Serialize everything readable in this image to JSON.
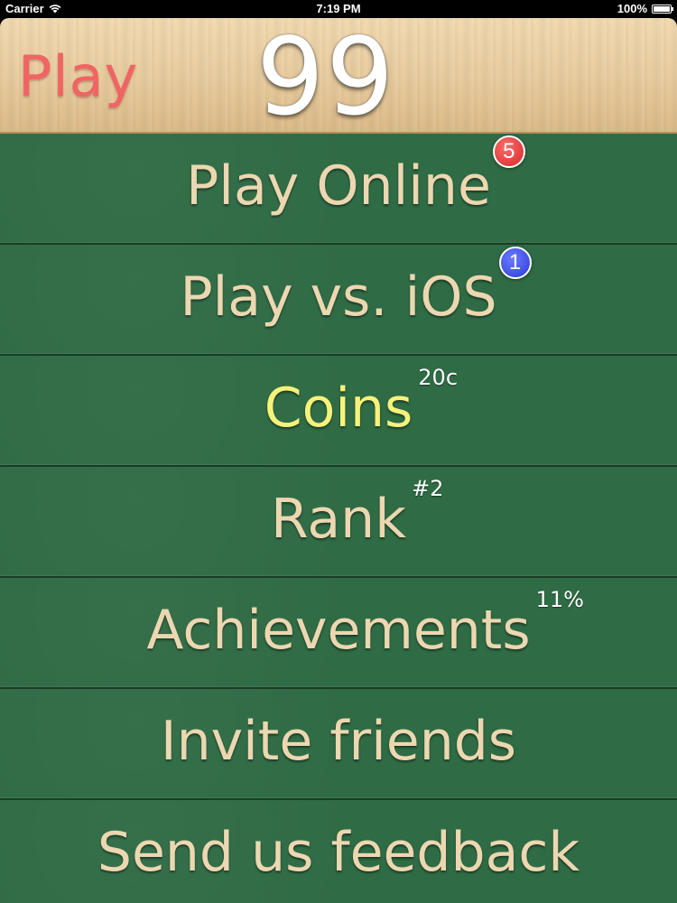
{
  "status_bar": {
    "carrier": "Carrier",
    "time": "7:19 PM",
    "battery": "100%"
  },
  "header": {
    "title": "Play",
    "score": "99"
  },
  "menu": {
    "items": [
      {
        "label": "Play Online",
        "badge": "5"
      },
      {
        "label": "Play vs. iOS",
        "badge": "1"
      },
      {
        "label": "Coins",
        "superscript": "20c"
      },
      {
        "label": "Rank",
        "superscript": "#2"
      },
      {
        "label": "Achievements",
        "superscript": "11%"
      },
      {
        "label": "Invite friends"
      },
      {
        "label": "Send us feedback"
      }
    ]
  },
  "colors": {
    "felt_green": "#2f6b45",
    "title_red": "#f06464",
    "label_tan": "#ecd7b1",
    "coins_yellow": "#f6f27a",
    "badge_red": "#d02a2a",
    "badge_blue": "#2c3bd6"
  },
  "icons": {
    "wifi": "wifi-icon",
    "battery": "battery-icon"
  }
}
